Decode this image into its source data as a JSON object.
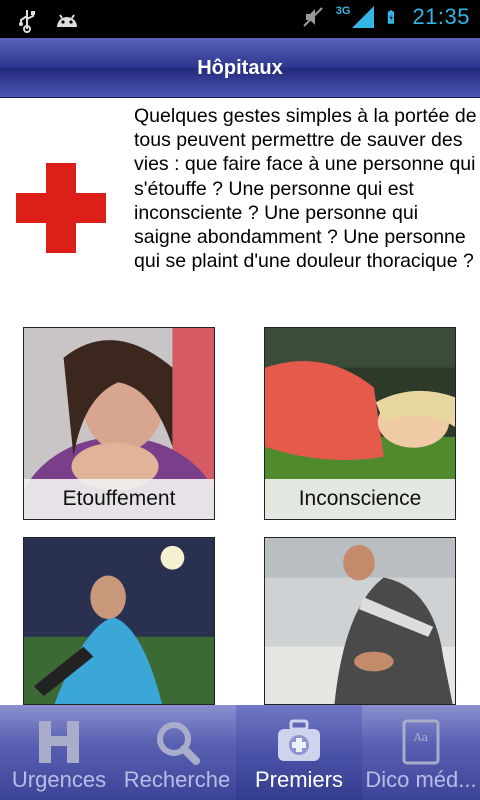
{
  "status_bar": {
    "time": "21:35",
    "network": "3G",
    "icons": [
      "usb-icon",
      "android-icon",
      "mute-icon",
      "signal-icon",
      "battery-icon"
    ]
  },
  "header": {
    "title": "Hôpitaux"
  },
  "intro": {
    "icon": "red-cross-icon",
    "text": "Quelques gestes simples à la portée de tous peuvent permettre de sauver des vies : que faire face à une personne qui s'étouffe ? Une personne qui est inconsciente ? Une personne qui saigne abondamment ? Une personne qui se plaint d'une douleur thoracique ?"
  },
  "tiles": [
    {
      "label": "Etouffement"
    },
    {
      "label": "Inconscience"
    },
    {
      "label": ""
    },
    {
      "label": ""
    }
  ],
  "tabs": [
    {
      "label": "Urgences",
      "icon": "hospital-h-icon",
      "active": false
    },
    {
      "label": "Recherche",
      "icon": "search-icon",
      "active": false
    },
    {
      "label": "Premiers",
      "icon": "first-aid-kit-icon",
      "active": true
    },
    {
      "label": "Dico méd...",
      "icon": "dictionary-icon",
      "active": false
    }
  ],
  "colors": {
    "accent": "#33b5e5",
    "bar": "#2d3691",
    "cross": "#dd1f1a"
  }
}
